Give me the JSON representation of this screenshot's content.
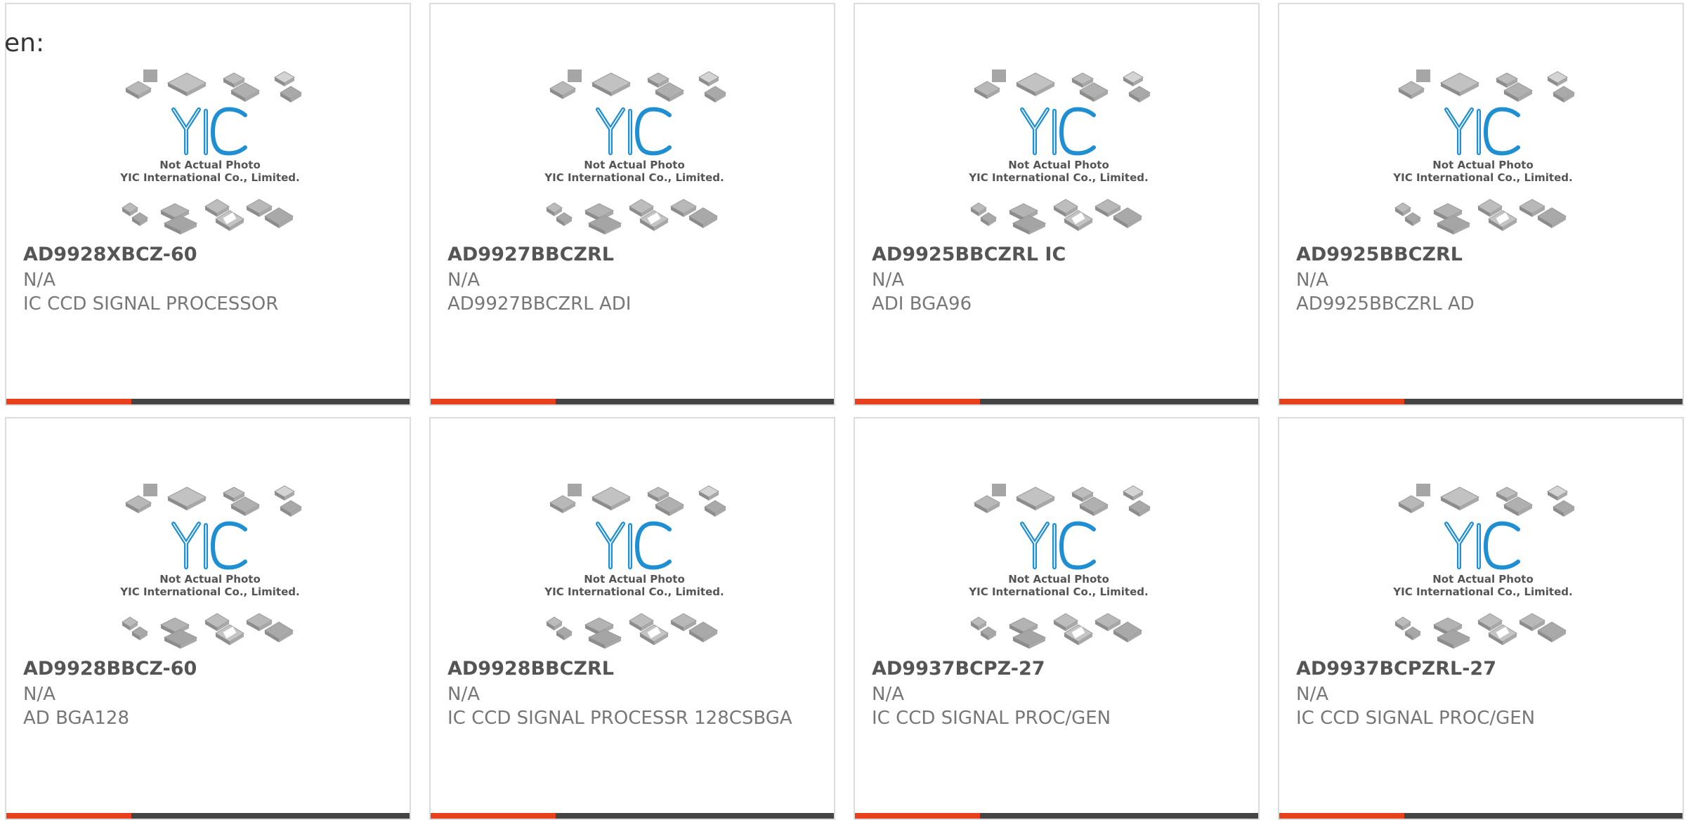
{
  "language_label": "en:",
  "colors": {
    "accent": "#e8401c",
    "bar": "#444444",
    "logo_blue": "#1f8fd4"
  },
  "photo_caption": {
    "line1": "Not Actual Photo",
    "line2": "YIC International Co., Limited."
  },
  "accent_fraction": 0.31,
  "products": [
    {
      "part": "AD9928XBCZ-60",
      "manufacturer": "N/A",
      "description": "IC CCD SIGNAL PROCESSOR"
    },
    {
      "part": "AD9927BBCZRL",
      "manufacturer": "N/A",
      "description": "AD9927BBCZRL ADI"
    },
    {
      "part": "AD9925BBCZRL IC",
      "manufacturer": "N/A",
      "description": "ADI BGA96"
    },
    {
      "part": "AD9925BBCZRL",
      "manufacturer": "N/A",
      "description": "AD9925BBCZRL AD"
    },
    {
      "part": "AD9928BBCZ-60",
      "manufacturer": "N/A",
      "description": "AD BGA128"
    },
    {
      "part": "AD9928BBCZRL",
      "manufacturer": "N/A",
      "description": "IC CCD SIGNAL PROCESSR 128CSBGA"
    },
    {
      "part": "AD9937BCPZ-27",
      "manufacturer": "N/A",
      "description": "IC CCD SIGNAL PROC/GEN"
    },
    {
      "part": "AD9937BCPZRL-27",
      "manufacturer": "N/A",
      "description": "IC CCD SIGNAL PROC/GEN"
    }
  ]
}
